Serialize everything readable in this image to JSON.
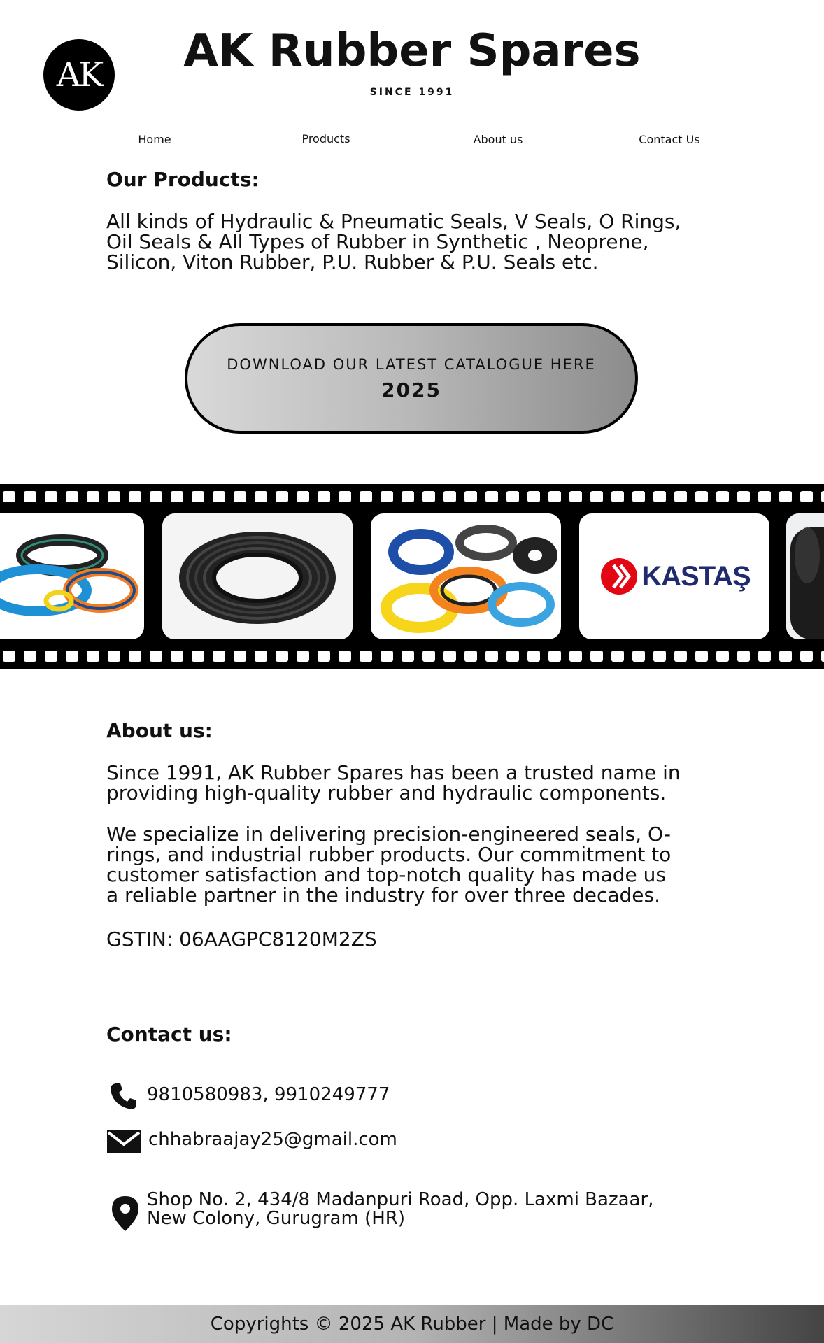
{
  "header": {
    "logo_text": "AK",
    "title": "AK Rubber Spares",
    "since": "SINCE 1991"
  },
  "nav": [
    "Home",
    "Products",
    "About us",
    "Contact Us"
  ],
  "products": {
    "heading": "Our Products:",
    "lines": [
      "All kinds of Hydraulic & Pneumatic Seals, V Seals, O Rings,",
      "Oil Seals & All Types of Rubber in Synthetic , Neoprene,",
      "Silicon, Viton Rubber, P.U. Rubber & P.U. Seals etc."
    ]
  },
  "catalogue": {
    "label": "DOWNLOAD OUR LATEST CATALOGUE HERE",
    "year": "2025"
  },
  "film_strip": {
    "brand_logo_text": "KASTAŞ",
    "brand_color": "#e30613",
    "brand_text_color": "#1f2b6e"
  },
  "about": {
    "heading": "About us:",
    "para1_lines": [
      "Since 1991, AK Rubber Spares has been a trusted name in",
      "providing high-quality rubber and hydraulic components."
    ],
    "para2_lines": [
      "We specialize in delivering precision-engineered seals, O-",
      "rings, and industrial rubber products. Our commitment to",
      "customer satisfaction and top-notch quality has made us",
      "a reliable partner in the industry for over three decades."
    ],
    "gstin": "GSTIN: 06AAGPC8120M2ZS"
  },
  "contact": {
    "heading": "Contact us:",
    "phone": "9810580983, 9910249777",
    "email": "chhabraajay25@gmail.com",
    "address_lines": [
      "Shop No. 2, 434/8 Madanpuri Road, Opp. Laxmi Bazaar,",
      "New Colony, Gurugram (HR)"
    ]
  },
  "footer": {
    "text": "Copyrights © 2025 AK Rubber | Made by DC"
  }
}
